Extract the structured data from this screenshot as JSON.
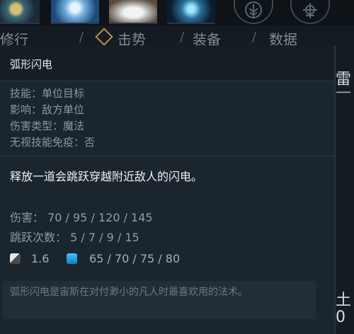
{
  "hero_strip": {
    "portraits": [
      "hero-portrait",
      "hero-portrait",
      "zeus-portrait",
      "hero-portrait"
    ],
    "emblems": [
      "tree-emblem-icon",
      "ornament-emblem-icon"
    ]
  },
  "tabs": [
    {
      "label": "修行"
    },
    {
      "label": "击势"
    },
    {
      "label": "装备"
    },
    {
      "label": "数据"
    }
  ],
  "tab_separator": "/",
  "right_fragments": [
    "雷",
    "一",
    "土",
    "0"
  ],
  "tooltip": {
    "title": "弧形闪电",
    "attributes": [
      "技能：单位目标",
      "影响：敌方单位",
      "伤害类型：魔法",
      "无视技能免疫：否"
    ],
    "description": "释放一道会跳跃穿越附近敌人的闪电。",
    "stats": [
      {
        "label": "伤害：",
        "value": "70 / 95 / 120 / 145"
      },
      {
        "label": "跳跃次数：",
        "value": "5 / 7 / 9 / 15"
      }
    ],
    "cooldown": {
      "icon": "cooldown-icon",
      "value": "1.6"
    },
    "mana": {
      "icon": "mana-icon",
      "value": "65 / 70 / 75 / 80"
    },
    "lore": "弧形闪电是宙斯在对付渺小的凡人时最喜欢用的法术。"
  }
}
